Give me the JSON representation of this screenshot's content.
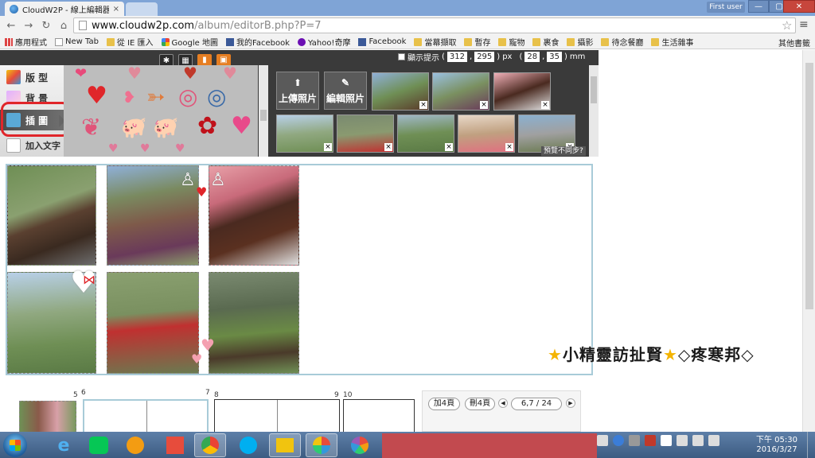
{
  "browser": {
    "tab_title": "CloudW2P - 線上編輯器",
    "tab_close": "×",
    "user": "First user",
    "win_min": "—",
    "win_max": "▢",
    "win_close": "✕",
    "url_host": "www.cloudw2p.com",
    "url_path": "/album/editorB.php?P=7",
    "bookmarks": [
      {
        "label": "應用程式",
        "icon": "apps"
      },
      {
        "label": "New Tab",
        "icon": "page"
      },
      {
        "label": "從 IE 匯入",
        "icon": "folder"
      },
      {
        "label": "Google 地圖",
        "icon": "google"
      },
      {
        "label": "我的Facebook",
        "icon": "fb"
      },
      {
        "label": "Yahoo!奇摩",
        "icon": "yahoo"
      },
      {
        "label": "Facebook",
        "icon": "fb"
      },
      {
        "label": "當幕擷取",
        "icon": "folder"
      },
      {
        "label": "暫存",
        "icon": "folder"
      },
      {
        "label": "寵物",
        "icon": "folder"
      },
      {
        "label": "裹食",
        "icon": "folder"
      },
      {
        "label": "攝影",
        "icon": "folder"
      },
      {
        "label": "待念餐廳",
        "icon": "folder"
      },
      {
        "label": "生活雜事",
        "icon": "folder"
      }
    ],
    "other_bookmarks": "其他書籤"
  },
  "editor": {
    "display_hint": "顯示提示",
    "x": "312",
    "y": "295",
    "unit_px": "px",
    "w": "28",
    "h": "35",
    "unit_mm": "mm",
    "nav": [
      {
        "label": "版 型"
      },
      {
        "label": "背 景"
      },
      {
        "label": "插 圖"
      },
      {
        "label": "加入文字"
      }
    ],
    "upload_label": "上傳照片",
    "edit_label": "編輯照片",
    "preview_note": "預覽不同步?",
    "remove_mark": "×"
  },
  "pages": {
    "numbers": [
      "5",
      "6",
      "7",
      "8",
      "9",
      "10"
    ],
    "add_btn": "加4頁",
    "del_btn": "刪4頁",
    "current": "6,7 / 24",
    "prev": "◀",
    "next": "▶"
  },
  "watermark": {
    "star_left": "★",
    "text": "小精靈訪扯賢",
    "star_mid": "★",
    "diamond1": "◇",
    "text2": "疼寒邦",
    "diamond2": "◇"
  },
  "taskbar": {
    "time": "下午 05:30",
    "date": "2016/3/27"
  },
  "colors": {
    "highlight_ring": "#e0262a",
    "canvas_border": "#a8cbd8",
    "taskbar": "#3d5c82"
  }
}
